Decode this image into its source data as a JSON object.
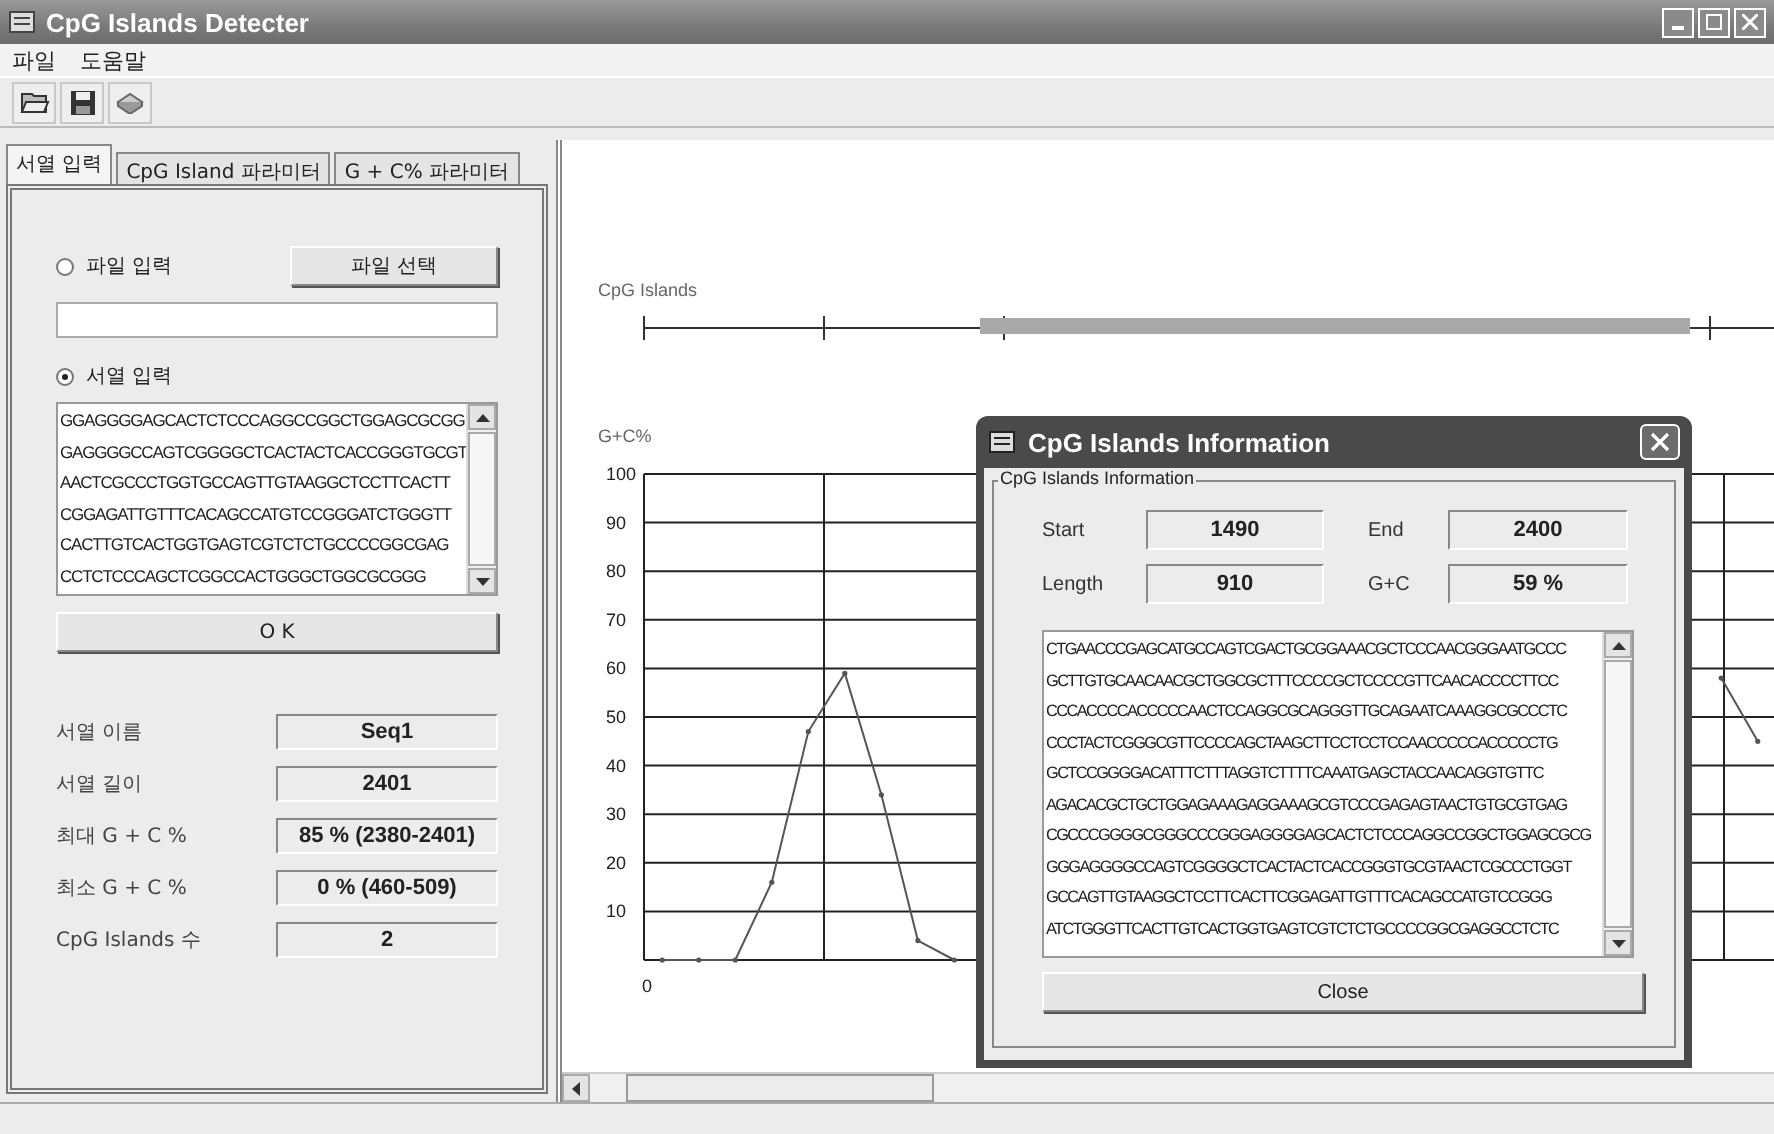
{
  "window": {
    "title": "CpG Islands Detecter"
  },
  "menu": [
    "파일",
    "도움말"
  ],
  "tabs": [
    {
      "label": "서열 입력",
      "selected": true
    },
    {
      "label": "CpG Island 파라미터",
      "selected": false
    },
    {
      "label": "G + C% 파라미터",
      "selected": false
    }
  ],
  "input": {
    "file_radio": {
      "label": "파일 입력",
      "selected": false
    },
    "file_button": "파일 선택",
    "sequence_radio": {
      "label": "서열 입력",
      "selected": true
    },
    "sequence_lines": [
      "GGAGGGGAGCACTCTCCCAGGCCGGCTGGAGCGCGG",
      "GAGGGGCCAGTCGGGGCTCACTACTCACCGGGTGCGT",
      "AACTCGCCCTGGTGCCAGTTGTAAGGCTCCTTCACTT",
      "CGGAGATTGTTTCACAGCCATGTCCGGGATCTGGGTT",
      "CACTTGTCACTGGTGAGTCGTCTCTGCCCCGGCGAG",
      "CCTCTCCCAGCTCGGCCACTGGGCTGGCGCGGG"
    ],
    "ok_button": "O  K"
  },
  "info": [
    {
      "label": "서열 이름",
      "value": "Seq1"
    },
    {
      "label": "서열 길이",
      "value": "2401"
    },
    {
      "label": "최대 G + C %",
      "value": "85 % (2380-2401)"
    },
    {
      "label": "최소 G + C %",
      "value": "0 % (460-509)"
    },
    {
      "label": "CpG Islands 수",
      "value": "2"
    }
  ],
  "track_label": "CpG Islands",
  "chart_data": {
    "type": "line",
    "ylabel": "G+C%",
    "grid": true,
    "ylim": [
      0,
      100
    ],
    "yticks": [
      10,
      20,
      30,
      40,
      50,
      60,
      70,
      80,
      90,
      100
    ],
    "annotations": [
      "0"
    ],
    "series": [
      {
        "values": [
          0,
          0,
          0,
          16,
          47,
          59,
          34,
          4,
          0,
          null,
          null,
          null,
          null,
          null,
          null,
          null,
          null,
          null,
          null,
          null,
          null,
          null,
          null,
          null,
          null,
          null,
          null,
          null,
          null,
          58,
          45
        ]
      }
    ]
  },
  "dialog": {
    "title": "CpG Islands Information",
    "group": "CpG Islands Information",
    "fields": [
      {
        "label": "Start",
        "value": "1490"
      },
      {
        "label": "End",
        "value": "2400"
      },
      {
        "label": "Length",
        "value": "910"
      },
      {
        "label": "G+C",
        "value": "59 %"
      }
    ],
    "sequence_lines": [
      "CTGAACCCGAGCATGCCAGTCGACTGCGGAAACGCTCCCAACGGGAATGCCC",
      "GCTTGTGCAACAACGCTGGCGCTTTCCCCGCTCCCCGTTCAACACCCCTTCC",
      "CCCACCCCACCCCCAACTCCAGGCGCAGGGTTGCAGAATCAAAGGCGCCCTC",
      "CCCTACTCGGGCGTTCCCCAGCTAAGCTTCCTCCTCCAACCCCCACCCCCTG",
      "GCTCCGGGGACATTTCTTTAGGTCTTTTCAAATGAGCTACCAACAGGTGTTC",
      "AGACACGCTGCTGGAGAAAGAGGAAAGCGTCCCGAGAGTAACTGTGCGTGAG",
      "CGCCCGGGGCGGGCCCGGGAGGGGAGCACTCTCCCAGGCCGGCTGGAGCGCG",
      "GGGAGGGGCCAGTCGGGGCTCACTACTCACCGGGTGCGTAACTCGCCCTGGT",
      "GCCAGTTGTAAGGCTCCTTCACTTCGGAGATTGTTTCACAGCCATGTCCGGG",
      "ATCTGGGTTCACTTGTCACTGGTGAGTCGTCTCTGCCCCGGCGAGGCCTCTC"
    ],
    "close_button": "Close"
  }
}
